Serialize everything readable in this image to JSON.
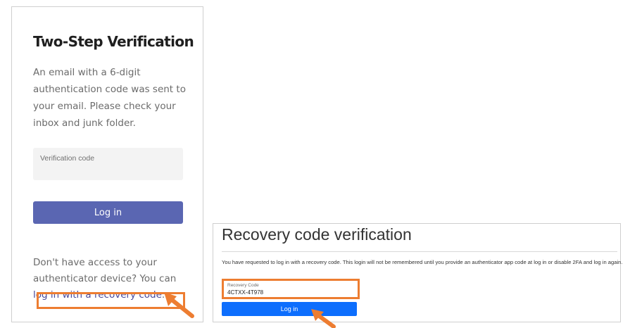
{
  "left_panel": {
    "title": "Two-Step Verification",
    "description": "An email with a 6-digit authentication code was sent to your email. Please check your inbox and junk folder.",
    "code_placeholder": "Verification code",
    "login_button": "Log in",
    "help_text": "Don't have access to your authenticator device? You can ",
    "recovery_link": "log in with a recovery code",
    "help_suffix": "."
  },
  "right_panel": {
    "title": "Recovery code verification",
    "description": "You have requested to log in with a recovery code. This login will not be remembered until you provide an authenticator app code at log in or disable 2FA and log in again.",
    "code_label": "Recovery Code",
    "code_value": "4CTXX-4T978",
    "login_button": "Log in"
  },
  "annotations": {
    "highlight_color": "#ed7d31",
    "arrow_icon": "arrow-pointer-icon"
  },
  "colors": {
    "left_button": "#5a66b2",
    "right_button": "#0d6efd"
  }
}
